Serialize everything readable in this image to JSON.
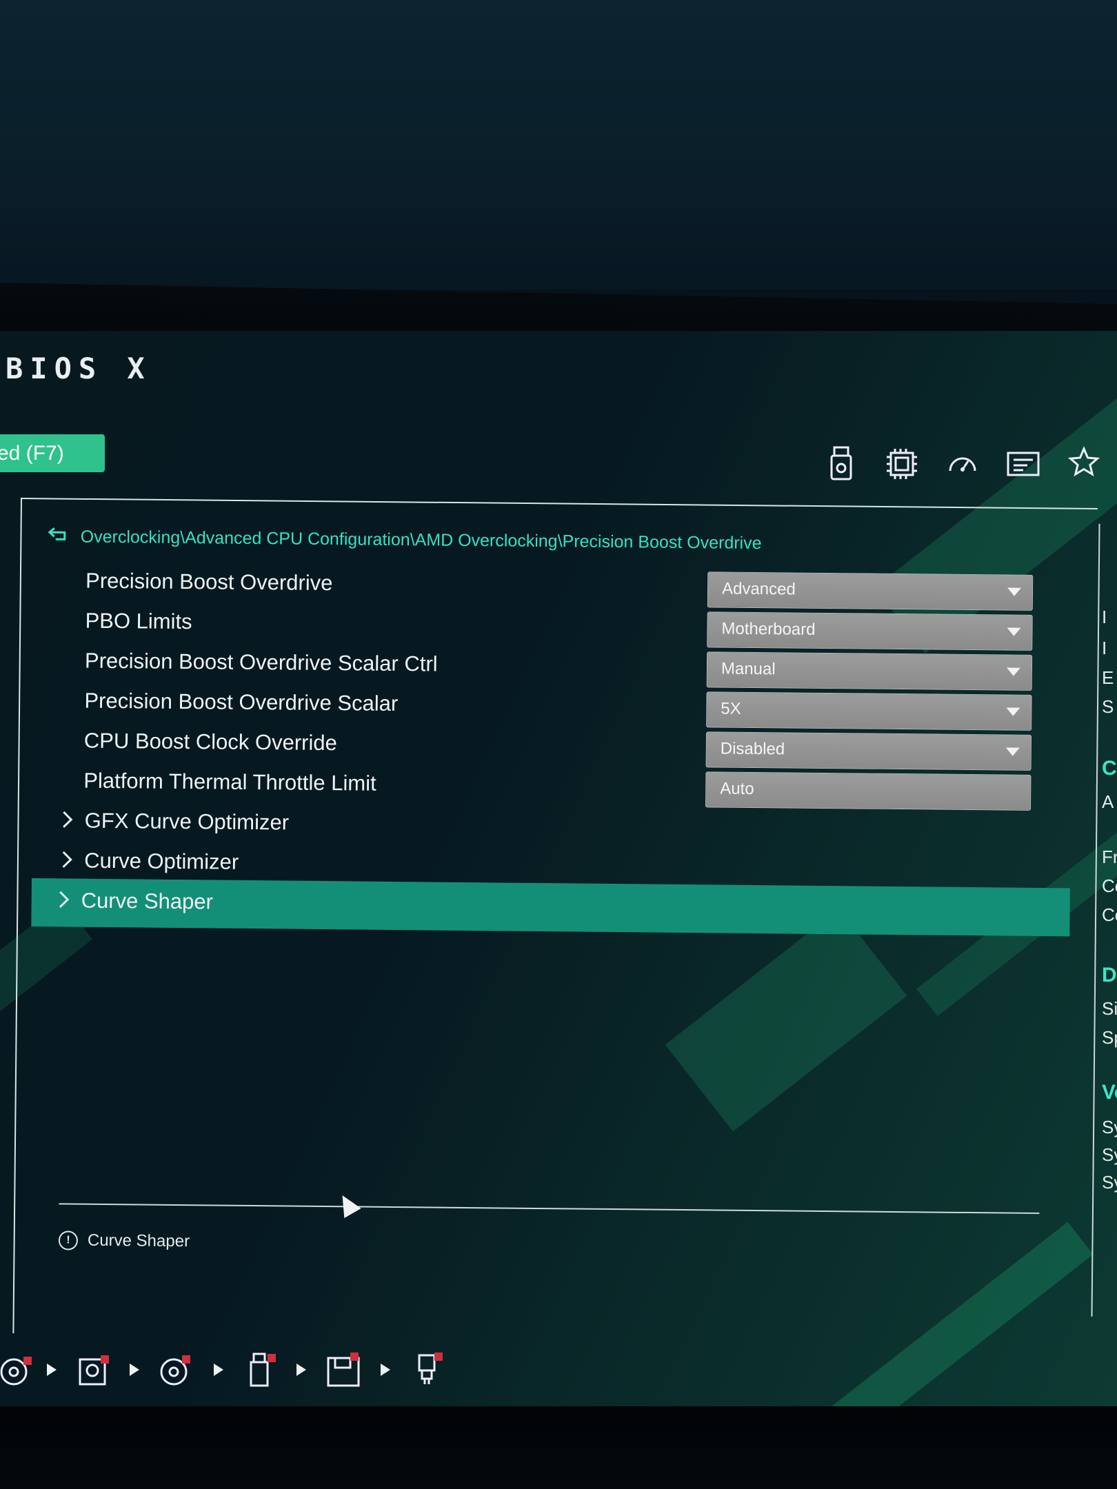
{
  "app": {
    "logo": "BIOS X",
    "mode_button": "ed (F7)"
  },
  "top_icons": [
    "usb-drive-icon",
    "cpu-chip-icon",
    "gauge-icon",
    "monitor-info-icon",
    "star-icon"
  ],
  "breadcrumb": "Overclocking\\Advanced CPU Configuration\\AMD Overclocking\\Precision Boost Overdrive",
  "settings": [
    {
      "label": "Precision Boost Overdrive",
      "value": "Advanced",
      "type": "dropdown"
    },
    {
      "label": "PBO Limits",
      "value": "Motherboard",
      "type": "dropdown"
    },
    {
      "label": "Precision Boost Overdrive Scalar Ctrl",
      "value": "Manual",
      "type": "dropdown"
    },
    {
      "label": "Precision Boost Overdrive Scalar",
      "value": "5X",
      "type": "dropdown"
    },
    {
      "label": "CPU Boost Clock Override",
      "value": "Disabled",
      "type": "dropdown"
    },
    {
      "label": "Platform Thermal Throttle Limit",
      "value": "Auto",
      "type": "field"
    }
  ],
  "submenus": [
    {
      "label": "GFX Curve Optimizer",
      "selected": false
    },
    {
      "label": "Curve Optimizer",
      "selected": false
    },
    {
      "label": "Curve Shaper",
      "selected": true
    }
  ],
  "help": {
    "text": "Curve Shaper"
  },
  "right_panel": {
    "lines": [
      "I",
      "I",
      "E",
      "S"
    ],
    "section_cpu": {
      "head": "C",
      "lines": [
        "A",
        "Fr",
        "Co",
        "Co"
      ]
    },
    "section_dram": {
      "head": "DI",
      "lines": [
        "Siz",
        "Sp"
      ]
    },
    "section_voltage": {
      "head": "Vo",
      "lines": [
        "Sys",
        "Sys",
        "Sys"
      ]
    }
  },
  "boot_order_icons": [
    "hdd-icon",
    "disk-icon",
    "hdd-icon",
    "usb-icon",
    "floppy-icon",
    "usb-key-icon"
  ],
  "colors": {
    "accent": "#36e2c4",
    "selected_row": "#138f78",
    "button_green": "#2fc28a",
    "dropdown_gray": "#939493"
  }
}
